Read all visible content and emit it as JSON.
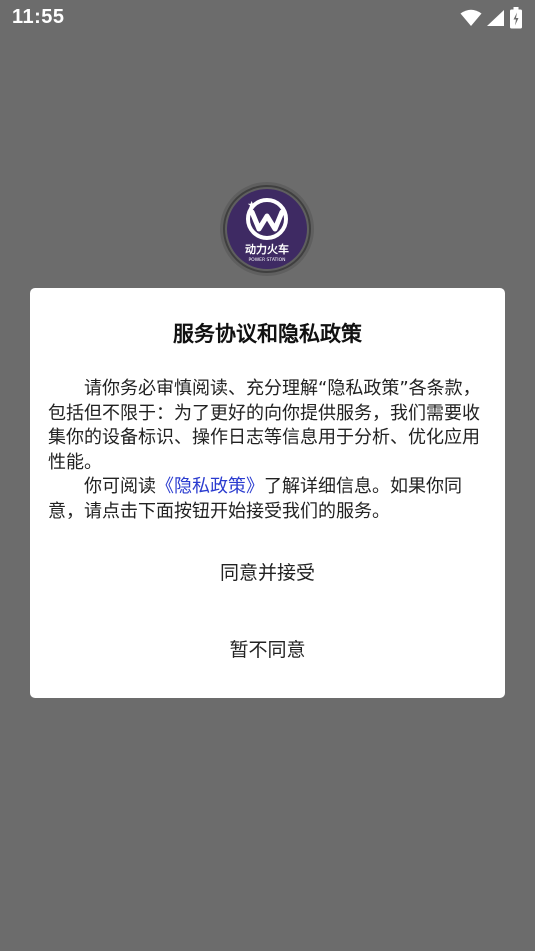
{
  "status_bar": {
    "time": "11:55",
    "icons": [
      "wifi-icon",
      "cellular-signal-icon",
      "battery-charging-icon"
    ]
  },
  "logo": {
    "name_cn": "动力火车",
    "name_en": "POWER STATION"
  },
  "dialog": {
    "title": "服务协议和隐私政策",
    "paragraph1": "请你务必审慎阅读、充分理解“隐私政策”各条款，包括但不限于：为了更好的向你提供服务，我们需要收集你的设备标识、操作日志等信息用于分析、优化应用性能。",
    "paragraph2_prefix": "你可阅读",
    "policy_link": "《隐私政策》",
    "paragraph2_suffix": "了解详细信息。如果你同意，请点击下面按钮开始接受我们的服务。",
    "agree_label": "同意并接受",
    "disagree_label": "暂不同意"
  },
  "colors": {
    "overlay_background": "#6c6c6c",
    "dialog_background": "#ffffff",
    "link": "#2a3bcf",
    "logo_purple": "#3e2a63"
  }
}
